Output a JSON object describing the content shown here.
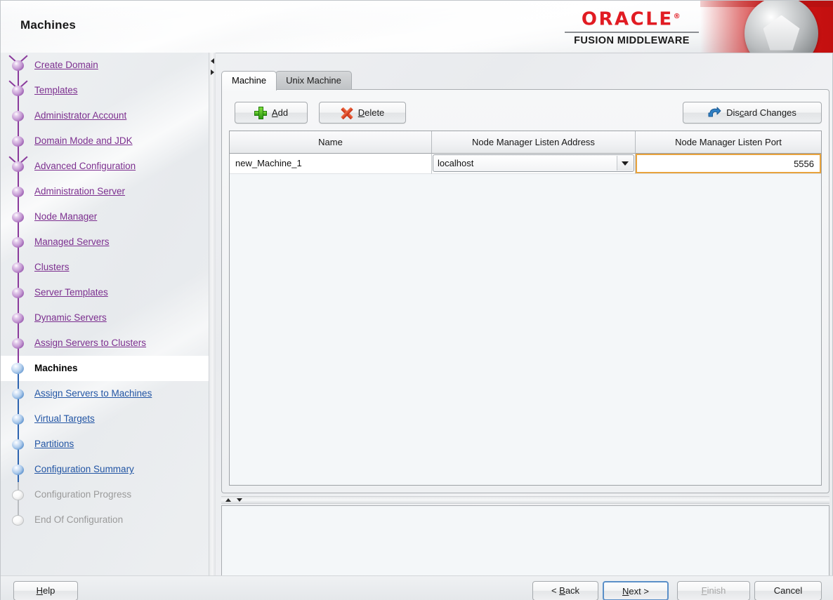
{
  "header": {
    "title": "Machines",
    "brand": "ORACLE",
    "brand_reg": "®",
    "brand_sub": "FUSION MIDDLEWARE",
    "orb_icon": "oracle-pentagon-orb-icon",
    "accent_red": "#cf1616",
    "brand_red": "#e11b22"
  },
  "sidebar": {
    "link_color": "#7c2f8f",
    "link_color_phase_b": "#2255a4",
    "items": [
      {
        "label": "Create Domain",
        "state": "done",
        "branch": true,
        "phase": "a"
      },
      {
        "label": "Templates",
        "state": "done",
        "branch": true,
        "phase": "a"
      },
      {
        "label": "Administrator Account",
        "state": "done",
        "branch": false,
        "phase": "a"
      },
      {
        "label": "Domain Mode and JDK",
        "state": "done",
        "branch": false,
        "phase": "a"
      },
      {
        "label": "Advanced Configuration",
        "state": "done",
        "branch": true,
        "phase": "a"
      },
      {
        "label": "Administration Server",
        "state": "done",
        "branch": false,
        "phase": "a"
      },
      {
        "label": "Node Manager",
        "state": "done",
        "branch": false,
        "phase": "a"
      },
      {
        "label": "Managed Servers",
        "state": "done",
        "branch": false,
        "phase": "a"
      },
      {
        "label": "Clusters",
        "state": "done",
        "branch": false,
        "phase": "a"
      },
      {
        "label": "Server Templates",
        "state": "done",
        "branch": false,
        "phase": "a"
      },
      {
        "label": "Dynamic Servers",
        "state": "done",
        "branch": false,
        "phase": "a"
      },
      {
        "label": "Assign Servers to Clusters",
        "state": "done",
        "branch": false,
        "phase": "a"
      },
      {
        "label": "Machines",
        "state": "current",
        "branch": false,
        "phase": "b"
      },
      {
        "label": "Assign Servers to Machines",
        "state": "todo",
        "branch": false,
        "phase": "b"
      },
      {
        "label": "Virtual Targets",
        "state": "todo",
        "branch": false,
        "phase": "b"
      },
      {
        "label": "Partitions",
        "state": "todo",
        "branch": false,
        "phase": "b"
      },
      {
        "label": "Configuration Summary",
        "state": "todo",
        "branch": false,
        "phase": "b"
      },
      {
        "label": "Configuration Progress",
        "state": "disabled",
        "branch": false,
        "phase": "b"
      },
      {
        "label": "End Of Configuration",
        "state": "disabled",
        "branch": false,
        "phase": "b"
      }
    ]
  },
  "content": {
    "tabs": [
      {
        "label": "Machine",
        "active": true
      },
      {
        "label": "Unix Machine",
        "active": false
      }
    ],
    "toolbar": {
      "add": {
        "label": "Add",
        "mnemonic": "A",
        "before": "",
        "after": "dd",
        "icon": "plus-icon"
      },
      "delete": {
        "label": "Delete",
        "mnemonic": "D",
        "before": "",
        "after": "elete",
        "icon": "x-icon"
      },
      "discard": {
        "label": "Discard Changes",
        "mnemonic": "c",
        "before": "Dis",
        "after": "ard Changes",
        "icon": "undo-icon"
      }
    },
    "table": {
      "columns": [
        "Name",
        "Node Manager Listen Address",
        "Node Manager Listen Port"
      ],
      "rows": [
        {
          "name": "new_Machine_1",
          "listen_address": "localhost",
          "listen_port": "5556",
          "address_control": "combobox",
          "port_focused": true,
          "focus_color": "#e8a33d"
        }
      ]
    }
  },
  "splitters": {
    "vertical_collapse_left_icon": "triangle-left-icon",
    "vertical_collapse_right_icon": "triangle-right-icon",
    "horizontal_collapse_up_icon": "triangle-up-icon",
    "horizontal_collapse_down_icon": "triangle-down-icon"
  },
  "footer": {
    "help": {
      "before": "",
      "mnemonic": "H",
      "after": "elp"
    },
    "back": {
      "before": "< ",
      "mnemonic": "B",
      "after": "ack"
    },
    "next": {
      "before": "",
      "mnemonic": "N",
      "after": "ext >",
      "focused": true
    },
    "finish": {
      "before": "",
      "mnemonic": "F",
      "after": "inish",
      "disabled": true
    },
    "cancel": {
      "before": "Cancel",
      "mnemonic": "",
      "after": ""
    }
  }
}
